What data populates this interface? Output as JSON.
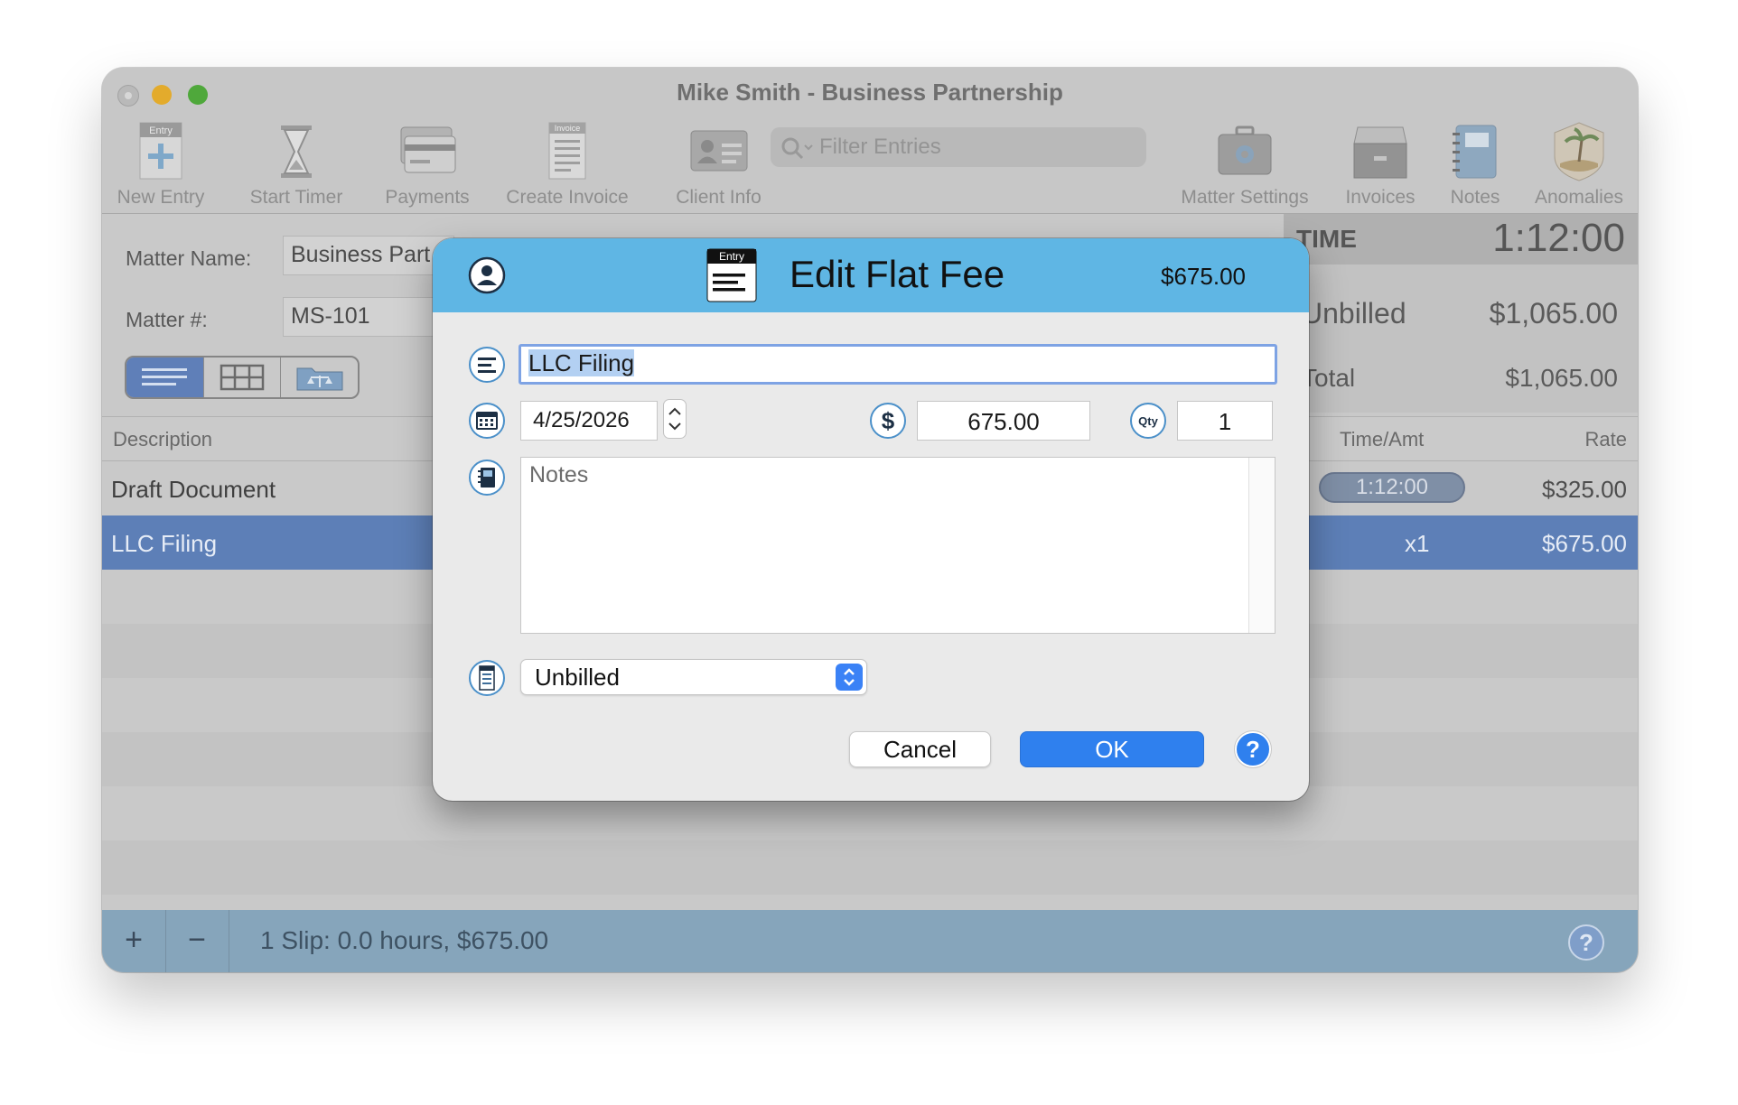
{
  "window": {
    "title": "Mike Smith - Business Partnership"
  },
  "toolbar": {
    "new_entry": "New Entry",
    "new_entry_badge": "Entry",
    "start_timer": "Start Timer",
    "payments": "Payments",
    "create_invoice": "Create Invoice",
    "create_invoice_badge": "Invoice",
    "client_info": "Client Info",
    "filter_placeholder": "Filter Entries",
    "matter_settings": "Matter Settings",
    "invoices": "Invoices",
    "notes": "Notes",
    "anomalies": "Anomalies"
  },
  "matter": {
    "name_label": "Matter Name:",
    "name_value": "Business Part",
    "number_label": "Matter #:",
    "number_value": "MS-101"
  },
  "summary": {
    "time_label": "TIME",
    "time_value": "1:12:00",
    "unbilled_label": "Unbilled",
    "unbilled_value": "$1,065.00",
    "total_label": "Total",
    "total_value": "$1,065.00"
  },
  "table": {
    "headers": {
      "description": "Description",
      "time_amt": "Time/Amt",
      "rate": "Rate"
    },
    "rows": [
      {
        "description": "Draft Document",
        "time_amt": "1:12:00",
        "rate": "$325.00"
      },
      {
        "description": "LLC Filing",
        "time_amt": "x1",
        "rate": "$675.00"
      }
    ]
  },
  "statusbar": {
    "add": "+",
    "remove": "−",
    "summary": "1 Slip: 0.0 hours, $675.00"
  },
  "dialog": {
    "title": "Edit Flat Fee",
    "header_badge": "Entry",
    "amount": "$675.00",
    "description_value": "LLC Filing",
    "date_value": "4/25/2026",
    "amount_value": "675.00",
    "qty_label": "Qty",
    "qty_value": "1",
    "notes_placeholder": "Notes",
    "status_value": "Unbilled",
    "cancel_label": "Cancel",
    "ok_label": "OK",
    "help_label": "?"
  },
  "colors": {
    "dialog_header": "#5fb6e4",
    "ok_button": "#2f80ee",
    "selected_row": "#5d7fb7",
    "statusbar": "#86a5bb"
  }
}
